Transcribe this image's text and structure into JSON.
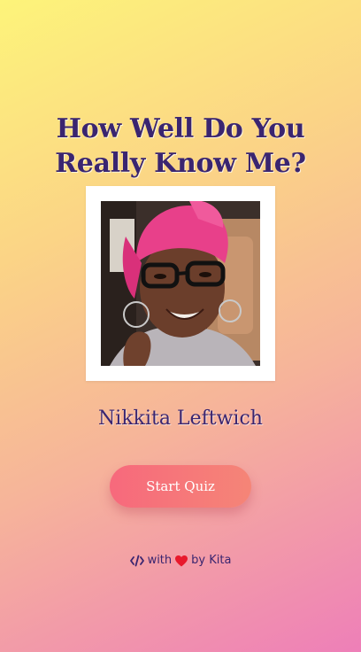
{
  "quiz": {
    "title_line1": "How Well Do You",
    "title_line2": "Really Know Me?",
    "photo_alt": "Nikkita Leftwich profile photo",
    "name": "Nikkita Leftwich",
    "start_label": "Start Quiz"
  },
  "footer": {
    "code_icon": "code-icon",
    "with_text": "with",
    "heart_icon": "heart-icon",
    "by_text": "by Kita"
  },
  "colors": {
    "title": "#3a2570",
    "button_start": "#f7697c",
    "button_end": "#f58577",
    "heart": "#e8192c"
  }
}
